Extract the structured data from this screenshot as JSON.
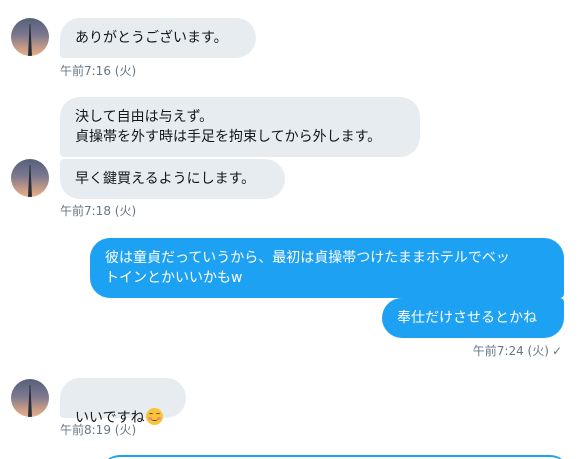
{
  "conversation": {
    "groups": [
      {
        "direction": "in",
        "messages": [
          "ありがとうございます。"
        ],
        "time": "午前7:16 (火)"
      },
      {
        "direction": "in",
        "messages": [
          "決して自由は与えず。\n貞操帯を外す時は手足を拘束してから外します。",
          "早く鍵買えるようにします。"
        ],
        "time": "午前7:18 (火)"
      },
      {
        "direction": "out",
        "messages": [
          "彼は童貞だっていうから、最初は貞操帯つけたままホテルでベッ\nトインとかいいかもw",
          "奉仕だけさせるとかね"
        ],
        "time": "午前7:24 (火)",
        "status": "✓"
      },
      {
        "direction": "in",
        "messages": [
          "いいですね"
        ],
        "emoji": "smiling-face-emoji",
        "time": "午前8:19 (火)"
      }
    ]
  },
  "colors": {
    "incoming_bubble": "#e6ecf0",
    "outgoing_bubble": "#1da1f2",
    "timestamp": "#657786"
  }
}
